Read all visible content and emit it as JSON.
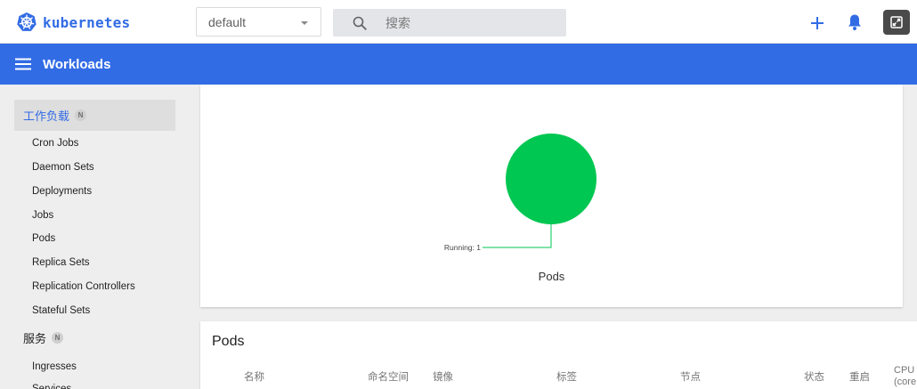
{
  "header": {
    "logo_text": "kubernetes",
    "namespace": {
      "value": "default"
    },
    "search": {
      "placeholder": "搜索"
    },
    "icons": [
      "kubernetes-logo-icon",
      "search-icon",
      "plus-icon",
      "bell-icon",
      "expand-icon"
    ]
  },
  "toolbar": {
    "title": "Workloads"
  },
  "sidebar": {
    "groups": [
      {
        "label": "工作负载",
        "badge": "N",
        "active": true
      },
      {
        "label": "服务",
        "badge": "N",
        "active": false
      }
    ],
    "workload_items": [
      "Cron Jobs",
      "Daemon Sets",
      "Deployments",
      "Jobs",
      "Pods",
      "Replica Sets",
      "Replication Controllers",
      "Stateful Sets"
    ],
    "service_items": [
      "Ingresses",
      "Services"
    ]
  },
  "chart_data": {
    "type": "pie",
    "title": "Pods",
    "slices": [
      {
        "label": "Running: 1",
        "value": 1,
        "color": "#00c752"
      }
    ]
  },
  "pods_table": {
    "title": "Pods",
    "columns": [
      "名称",
      "命名空间",
      "镜像",
      "标签",
      "节点",
      "状态",
      "重启",
      "CPU",
      "(core"
    ]
  },
  "colors": {
    "brand": "#326ce5",
    "running": "#00c752"
  }
}
